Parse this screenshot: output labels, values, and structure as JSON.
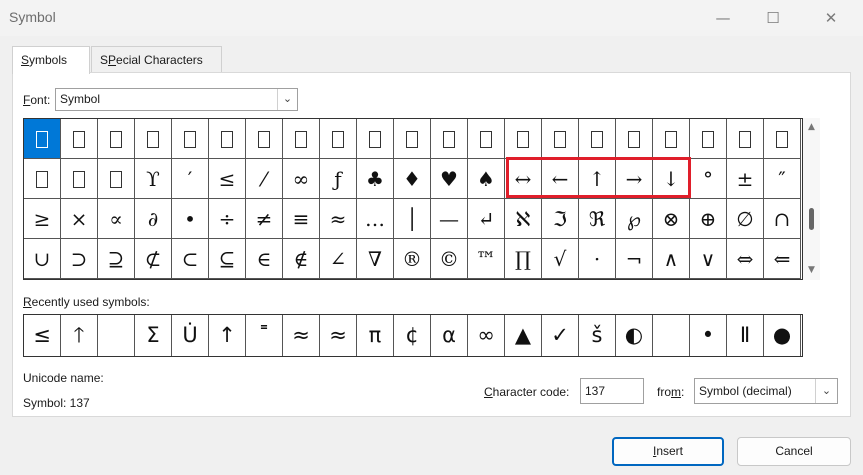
{
  "window": {
    "title": "Symbol",
    "minimize_glyph": "—",
    "maximize_glyph": "☐",
    "close_glyph": "✕"
  },
  "tabs": [
    {
      "label": "Symbols",
      "mnemonic": "S",
      "rest": "ymbols"
    },
    {
      "label": "Special Characters",
      "mnemonic": "P",
      "pre": "S",
      "rest": "ecial Characters"
    }
  ],
  "font": {
    "label_mnemonic": "F",
    "label_rest": "ont:",
    "value": "Symbol",
    "arrow": "⌄"
  },
  "symbol_grid": {
    "rows": [
      [
        "□",
        "□",
        "□",
        "□",
        "□",
        "□",
        "□",
        "□",
        "□",
        "□",
        "□",
        "□",
        "□",
        "□",
        "□",
        "□",
        "□",
        "□",
        "□",
        "□",
        "□"
      ],
      [
        "□",
        "□",
        "□",
        "ϒ",
        "′",
        "≤",
        "⁄",
        "∞",
        "ƒ",
        "♣",
        "♦",
        "♥",
        "♠",
        "↔",
        "←",
        "↑",
        "→",
        "↓",
        "°",
        "±",
        "″"
      ],
      [
        "≥",
        "×",
        "∝",
        "∂",
        "•",
        "÷",
        "≠",
        "≡",
        "≈",
        "…",
        "│",
        "—",
        "↵",
        "ℵ",
        "ℑ",
        "ℜ",
        "℘",
        "⊗",
        "⊕",
        "∅",
        "∩"
      ],
      [
        "∪",
        "⊃",
        "⊇",
        "⊄",
        "⊂",
        "⊆",
        "∈",
        "∉",
        "∠",
        "∇",
        "®",
        "©",
        "™",
        "∏",
        "√",
        "⋅",
        "¬",
        "∧",
        "∨",
        "⇔",
        "⇐"
      ]
    ],
    "selected_index": 0
  },
  "recently_used": {
    "label_mnemonic": "R",
    "label_rest": "ecently used symbols:",
    "items": [
      "≤",
      "🡑",
      "",
      "Σ",
      "U̇",
      "↑",
      "˭",
      "≈",
      "≈",
      "π",
      "¢",
      "α",
      "∞",
      "▲",
      "✓",
      "š",
      "◐",
      "",
      "•",
      "Ⅱ",
      "●"
    ]
  },
  "unicode_name": {
    "label": "Unicode name:",
    "value": "Symbol: 137"
  },
  "character_code": {
    "label_mnemonic": "C",
    "label_rest": "haracter code:",
    "value": "137"
  },
  "from": {
    "label_pre": "fro",
    "label_mnemonic": "m",
    "label_rest": ":",
    "value": "Symbol (decimal)",
    "arrow": "⌄"
  },
  "buttons": {
    "insert_mnemonic": "I",
    "insert_rest": "nsert",
    "cancel": "Cancel"
  },
  "scrollbar": {
    "up_glyph": "▲",
    "down_glyph": "▼"
  },
  "colors": {
    "selection": "#0078d7",
    "highlight_box": "#e01e2a"
  }
}
